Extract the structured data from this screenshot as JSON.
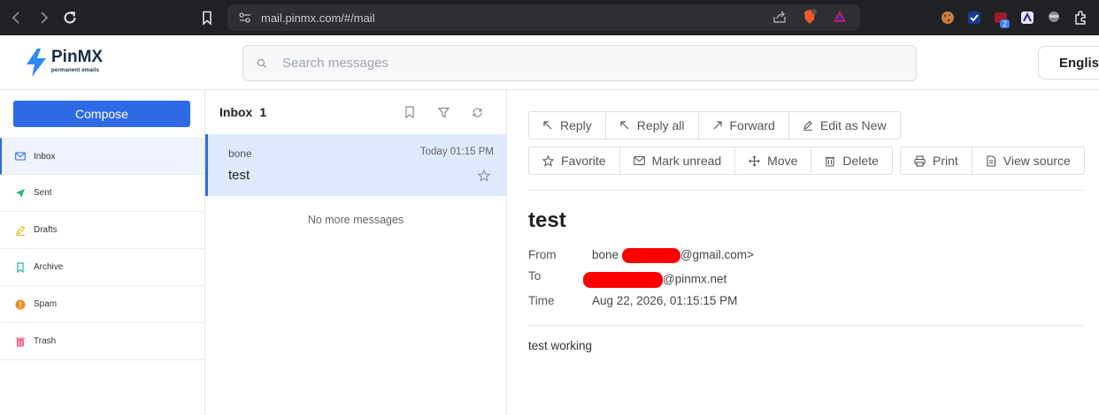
{
  "browser": {
    "url": "mail.pinmx.com/#/mail",
    "ext_badge": "2"
  },
  "app": {
    "logo_name_a": "Pin",
    "logo_name_b": "MX",
    "logo_sub": "permanent emails",
    "brand_color": "#2e6ae5",
    "search_placeholder": "Search messages",
    "language": "English"
  },
  "sidebar": {
    "compose_label": "Compose",
    "items": [
      {
        "label": "Inbox",
        "icon": "mail-icon",
        "active": true
      },
      {
        "label": "Sent",
        "icon": "send-icon"
      },
      {
        "label": "Drafts",
        "icon": "pencil-icon"
      },
      {
        "label": "Archive",
        "icon": "bookmark-icon"
      },
      {
        "label": "Spam",
        "icon": "warning-icon"
      },
      {
        "label": "Trash",
        "icon": "trash-icon"
      }
    ]
  },
  "list": {
    "title": "Inbox",
    "count": "1",
    "messages": [
      {
        "from": "bone",
        "time": "Today 01:15 PM",
        "subject": "test"
      }
    ],
    "footer": "No more messages"
  },
  "reader": {
    "actions_row1": [
      "Reply",
      "Reply all",
      "Forward",
      "Edit as New"
    ],
    "actions_row2a": [
      "Favorite",
      "Mark unread",
      "Move",
      "Delete"
    ],
    "actions_row2b": [
      "Print",
      "View source"
    ],
    "subject": "test",
    "from_label": "From",
    "from_name": "bone",
    "from_domain": "@gmail.com>",
    "to_label": "To",
    "to_domain": "@pinmx.net",
    "time_label": "Time",
    "time_value": "Aug 22, 2026, 01:15:15 PM",
    "body": "test working",
    "redaction_color": "#ff0000"
  }
}
